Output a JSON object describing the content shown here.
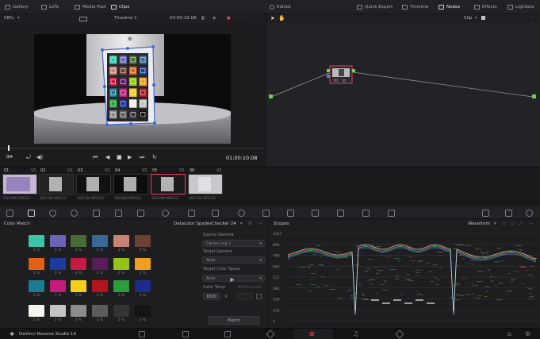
{
  "topbar": {
    "gallery": "Gallery",
    "luts": "LUTs",
    "media_pool": "Media Pool",
    "clips": "Clips",
    "edited": "Edited",
    "quick_export": "Quick Export",
    "timeline": "Timeline",
    "nodes": "Nodes",
    "effects": "Effects",
    "lightbox": "Lightbox"
  },
  "viewer": {
    "zoom": "58%",
    "timeline_name": "Timeline 1",
    "timecode_top": "00:00:10.08",
    "timecode_bottom": "01:00:10.08"
  },
  "nodes": {
    "mode": "Clip",
    "node_label": "01"
  },
  "clips": [
    {
      "num": "01",
      "track": "V1",
      "label": "XDCAM MPEG2"
    },
    {
      "num": "02",
      "track": "V1",
      "label": "XDCAM MPEG2"
    },
    {
      "num": "03",
      "track": "V1",
      "label": "XDCAM MPEG2"
    },
    {
      "num": "04",
      "track": "V1",
      "label": "XDCAM MPEG2"
    },
    {
      "num": "05",
      "track": "V1",
      "label": "XDCAM MPEG2"
    },
    {
      "num": "06",
      "track": "V1",
      "label": "XDCAM MPEG2"
    }
  ],
  "color_match": {
    "title": "Color Match",
    "chart": "Datacolor SpyderChecker 24",
    "source_gamma_label": "Source Gamma",
    "source_gamma": "Canon Log 2",
    "target_gamma_label": "Target Gamma",
    "target_gamma": "Auto",
    "target_space_label": "Target Color Space",
    "target_space": "Auto",
    "color_temp_label": "Color Temp",
    "color_temp": "6500",
    "color_temp_unit": "K",
    "white_level_label": "White Level",
    "match_button": "Match",
    "swatches": [
      {
        "color": "#3cc6a8",
        "label": "3 %"
      },
      {
        "color": "#6a64b4",
        "label": "4 %"
      },
      {
        "color": "#486a34",
        "label": "2 %"
      },
      {
        "color": "#3a6896",
        "label": "4 %"
      },
      {
        "color": "#c88374",
        "label": "2 %"
      },
      {
        "color": "#6c4034",
        "label": "3 %"
      },
      {
        "color": "#e06014",
        "label": "1 %"
      },
      {
        "color": "#1c3c9c",
        "label": "2 %"
      },
      {
        "color": "#c41c44",
        "label": "3 %"
      },
      {
        "color": "#5c1c5c",
        "label": "2 %"
      },
      {
        "color": "#94c41c",
        "label": "2 %"
      },
      {
        "color": "#f0a01c",
        "label": "2 %"
      },
      {
        "color": "#1c7c94",
        "label": "2 %"
      },
      {
        "color": "#c41c7c",
        "label": "3 %"
      },
      {
        "color": "#f4d01c",
        "label": "3 %"
      },
      {
        "color": "#b4141c",
        "label": "3 %"
      },
      {
        "color": "#2c9c3c",
        "label": "3 %"
      },
      {
        "color": "#1c2c8c",
        "label": "3 %"
      },
      {
        "color": "#f4f4f0",
        "label": "2 %"
      },
      {
        "color": "#c4c4c4",
        "label": "2 %"
      },
      {
        "color": "#8c8c8c",
        "label": "3 %"
      },
      {
        "color": "#5c5c5c",
        "label": "2 %"
      },
      {
        "color": "#343434",
        "label": "2 %"
      },
      {
        "color": "#141414",
        "label": "3 %"
      }
    ]
  },
  "scopes": {
    "title": "Scopes",
    "mode": "Waveform",
    "ticks": [
      "1023",
      "896",
      "768",
      "640",
      "512",
      "384",
      "256",
      "128",
      "0"
    ]
  },
  "app": {
    "name": "DaVinci Resolve Studio 19"
  },
  "colors": {
    "accent": "#e3415e",
    "panel": "#1e1e21",
    "node_green": "#6fd04f"
  }
}
